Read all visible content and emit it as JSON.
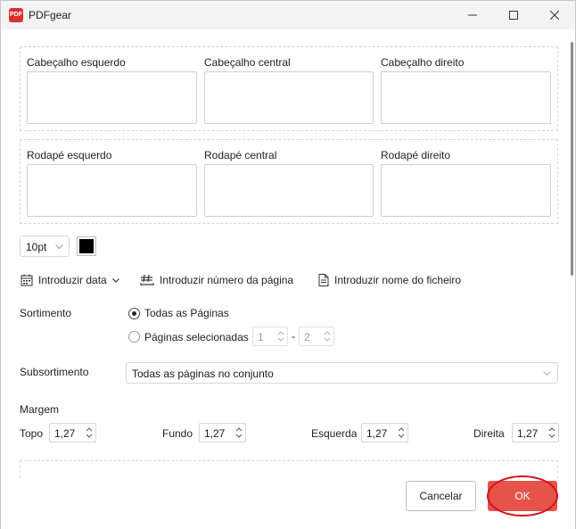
{
  "window": {
    "app_title": "PDFgear",
    "logo_text": "PDF"
  },
  "header_section": {
    "left_label": "Cabeçalho esquerdo",
    "center_label": "Cabeçalho central",
    "right_label": "Cabeçalho direito",
    "left_value": "",
    "center_value": "",
    "right_value": ""
  },
  "footer_section": {
    "left_label": "Rodapé esquerdo",
    "center_label": "Rodapé central",
    "right_label": "Rodapé direito",
    "left_value": "",
    "center_value": "",
    "right_value": ""
  },
  "font": {
    "size_value": "10pt",
    "color": "#000000"
  },
  "actions": {
    "insert_date": "Introduzir data",
    "insert_page_number": "Introduzir número da página",
    "insert_file_name": "Introduzir nome do ficheiro"
  },
  "range": {
    "label": "Sortimento",
    "all_pages": "Todas as Páginas",
    "selected_pages": "Páginas selecionadas",
    "from_value": "1",
    "separator": "-",
    "to_value": "2",
    "selected": "all_pages"
  },
  "subrange": {
    "label": "Subsortimento",
    "value": "Todas as páginas no conjunto"
  },
  "margin": {
    "label": "Margem",
    "top_label": "Topo",
    "top_value": "1,27",
    "bottom_label": "Fundo",
    "bottom_value": "1,27",
    "left_label": "Esquerda",
    "left_value": "1,27",
    "right_label": "Direita",
    "right_value": "1,27"
  },
  "buttons": {
    "cancel": "Cancelar",
    "ok": "OK"
  },
  "colors": {
    "accent": "#e5534b",
    "highlight": "#d4121a"
  }
}
